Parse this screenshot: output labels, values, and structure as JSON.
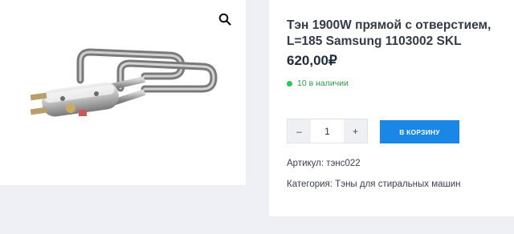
{
  "product": {
    "title": "Тэн 1900W прямой с отверстием, L=185 Samsung 1103002 SKL",
    "price": "620,00₽",
    "stock": "10 в наличии",
    "quantity": "1",
    "qty_minus": "–",
    "qty_plus": "+",
    "add_to_cart": "В КОРЗИНУ",
    "sku_label": "Артикул:",
    "sku_value": "тэнс022",
    "category_label": "Категория:",
    "category_value": "Тэны для стиральных машин"
  },
  "icons": {
    "zoom": "search-icon",
    "stock": "in-stock-dot"
  },
  "colors": {
    "accent": "#1a86e6",
    "stock_green": "#2ec45a",
    "background": "#eef0f5"
  }
}
